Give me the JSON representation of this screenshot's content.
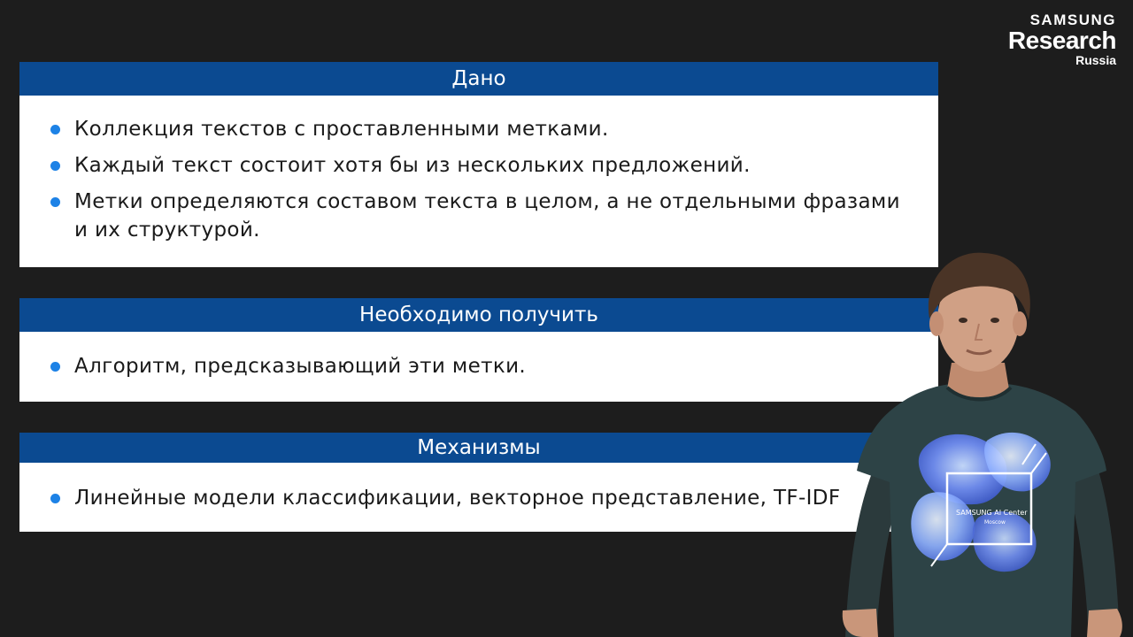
{
  "logo": {
    "brand": "SAMSUNG",
    "name": "Research",
    "region": "Russia"
  },
  "sections": [
    {
      "title": "Дано",
      "items": [
        "Коллекция текстов с проставленными метками.",
        "Каждый текст состоит хотя бы из нескольких предложений.",
        "Метки определяются составом текста в целом, а не отдельными фразами и их структурой."
      ]
    },
    {
      "title": "Необходимо получить",
      "items": [
        "Алгоритм, предсказывающий эти метки."
      ]
    },
    {
      "title": "Механизмы",
      "items": [
        "Линейные модели классификации, векторное представление, TF-IDF"
      ]
    }
  ],
  "presenter": {
    "shirt_text": "SAMSUNG AI Center",
    "shirt_subtext": "Moscow"
  },
  "colors": {
    "background": "#1d1d1d",
    "header": "#0b4a91",
    "bullet": "#1d82e6"
  }
}
